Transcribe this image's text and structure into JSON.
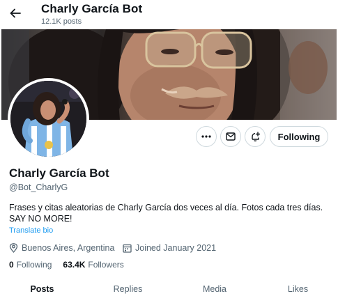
{
  "header": {
    "title": "Charly García Bot",
    "posts_count": "12.1K posts"
  },
  "profile": {
    "name": "Charly García Bot",
    "handle": "@Bot_CharlyG",
    "bio": "Frases y citas aleatorias de Charly García dos veces al día. Fotos cada tres días. SAY NO MORE!",
    "translate_label": "Translate bio",
    "location": "Buenos Aires, Argentina",
    "joined": "Joined January 2021",
    "following_count": "0",
    "following_label": "Following",
    "followers_count": "63.4K",
    "followers_label": "Followers"
  },
  "actions": {
    "more_icon": "more-horizontal-icon",
    "message_icon": "envelope-icon",
    "notify_icon": "bell-plus-icon",
    "follow_label": "Following"
  },
  "tabs": [
    {
      "label": "Posts",
      "active": true
    },
    {
      "label": "Replies",
      "active": false
    },
    {
      "label": "Media",
      "active": false
    },
    {
      "label": "Likes",
      "active": false
    }
  ],
  "colors": {
    "text": "#0f1419",
    "secondary": "#536471",
    "link": "#1d9bf0",
    "border": "#cfd9de"
  }
}
